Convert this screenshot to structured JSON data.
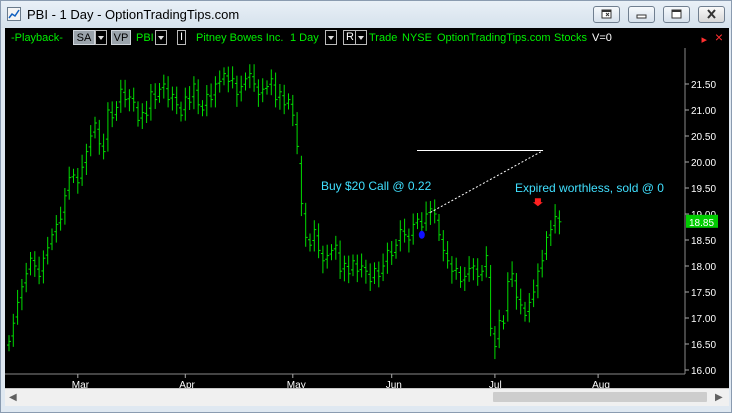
{
  "window": {
    "title": "PBI - 1 Day - OptionTradingTips.com"
  },
  "toolbar": {
    "playback_label": "-Playback-",
    "sa_label": "SA",
    "vp_label": "VP",
    "symbol_label": "PBI",
    "i_label": "I",
    "company_label": "Pitney Bowes Inc.",
    "interval_label": "1 Day",
    "r_label": "R",
    "trade_label": "Trade",
    "exchange_label": "NYSE",
    "site_label": "OptionTradingTips.com",
    "stocks_label": "Stocks",
    "volume_label": "V=0",
    "pin_icon": "pin-icon",
    "close_icon": "close-icon"
  },
  "colors": {
    "bar": "#00dd00",
    "annotation_text": "#40e0ff",
    "last_price_bg": "#00cc00",
    "buy_marker": "#1010ff",
    "sell_marker": "#ff2020",
    "background": "#000000"
  },
  "chart_data": {
    "type": "ohlc",
    "y_ticks": [
      "21.50",
      "21.00",
      "20.50",
      "20.00",
      "19.50",
      "19.00",
      "18.50",
      "18.00",
      "17.50",
      "17.00",
      "16.50",
      "16.00"
    ],
    "ylim": [
      16.0,
      22.4
    ],
    "x_ticks": [
      "Mar",
      "Apr",
      "May",
      "Jun",
      "Jul",
      "Aug"
    ],
    "last_price": "18.85",
    "annotations": {
      "buy": "Buy $20 Call @ 0.22",
      "expired": "Expired worthless, sold @ 0"
    },
    "trendline": {
      "from_date": "Jun 9",
      "from_price": 19.03,
      "to_date": "Jul 15",
      "to_price": 20.22
    },
    "target_line": {
      "price": 20.22
    },
    "closes": [
      16.55,
      16.9,
      17.3,
      17.6,
      17.85,
      18.15,
      18.0,
      17.8,
      18.15,
      18.35,
      18.6,
      18.8,
      18.9,
      19.35,
      19.7,
      19.75,
      19.6,
      19.9,
      20.2,
      20.5,
      20.75,
      20.35,
      20.2,
      21.0,
      20.85,
      21.05,
      21.4,
      21.2,
      21.25,
      21.15,
      20.8,
      20.95,
      20.9,
      21.35,
      21.2,
      21.4,
      21.5,
      21.2,
      21.3,
      21.1,
      20.9,
      21.25,
      21.15,
      21.5,
      21.1,
      21.0,
      21.3,
      21.2,
      21.5,
      21.55,
      21.7,
      21.55,
      21.6,
      21.3,
      21.45,
      21.6,
      21.7,
      21.5,
      21.3,
      21.4,
      21.45,
      21.6,
      21.2,
      21.35,
      21.1,
      21.2,
      20.9,
      20.3,
      19.2,
      18.55,
      18.4,
      18.7,
      18.3,
      18.1,
      18.2,
      18.3,
      18.4,
      17.9,
      18.05,
      17.85,
      18.1,
      17.9,
      18.0,
      17.9,
      17.7,
      17.95,
      17.8,
      18.0,
      18.3,
      18.2,
      18.4,
      18.7,
      18.6,
      18.5,
      18.8,
      18.9,
      18.75,
      19.0,
      19.1,
      19.0,
      18.6,
      18.3,
      18.1,
      17.9,
      17.95,
      17.7,
      17.8,
      17.95,
      18.0,
      17.8,
      17.9,
      18.2,
      16.8,
      16.45,
      16.95,
      16.9,
      17.7,
      17.85,
      17.4,
      17.25,
      17.05,
      17.3,
      17.5,
      17.9,
      18.1,
      18.55,
      18.7,
      18.95,
      18.85
    ]
  }
}
